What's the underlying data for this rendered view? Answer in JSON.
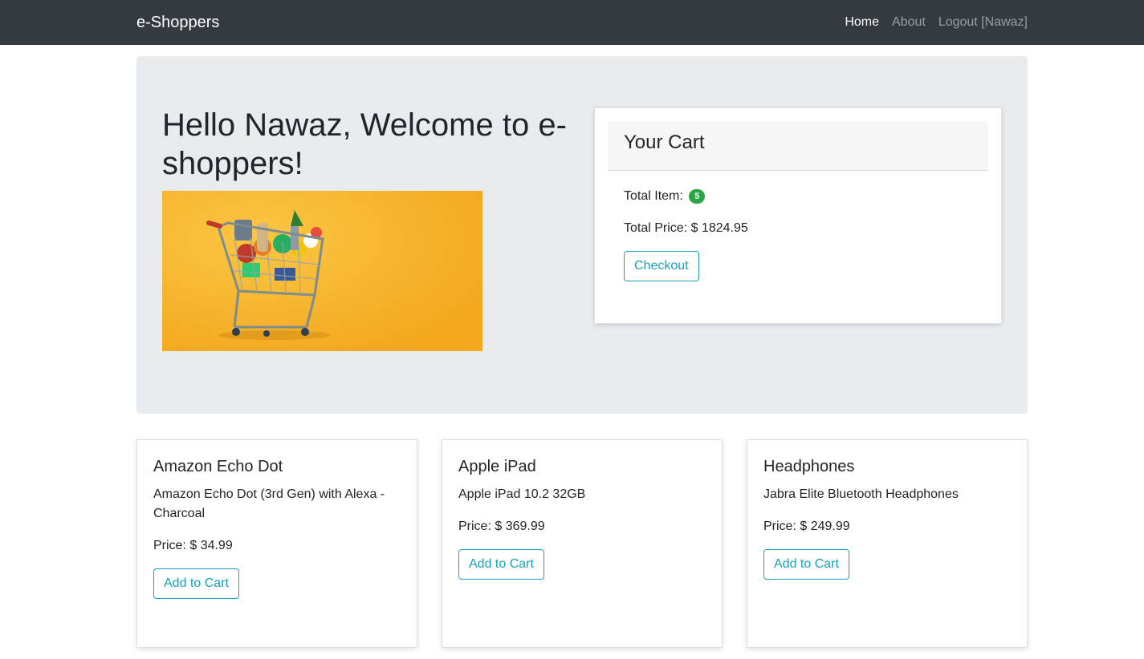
{
  "navbar": {
    "brand": "e-Shoppers",
    "links": [
      {
        "label": "Home",
        "active": true
      },
      {
        "label": "About",
        "active": false
      },
      {
        "label": "Logout [Nawaz]",
        "active": false
      }
    ]
  },
  "hero": {
    "title": "Hello Nawaz, Welcome to e-shoppers!",
    "image_bg_color": "#f7b72e"
  },
  "cart": {
    "title": "Your Cart",
    "total_item_label": "Total Item:",
    "total_item_count": "5",
    "total_price_label": "Total Price: $ 1824.95",
    "checkout_label": "Checkout"
  },
  "products": [
    {
      "name": "Amazon Echo Dot",
      "description": "Amazon Echo Dot (3rd Gen) with Alexa - Charcoal",
      "price": "Price: $ 34.99",
      "button": "Add to Cart"
    },
    {
      "name": "Apple iPad",
      "description": "Apple iPad 10.2 32GB",
      "price": "Price: $ 369.99",
      "button": "Add to Cart"
    },
    {
      "name": "Headphones",
      "description": "Jabra Elite Bluetooth Headphones",
      "price": "Price: $ 249.99",
      "button": "Add to Cart"
    }
  ],
  "colors": {
    "navbar": "#343a40",
    "jumbotron": "#e9ecef",
    "badge": "#28a745",
    "button_outline": "#17a2b8"
  }
}
